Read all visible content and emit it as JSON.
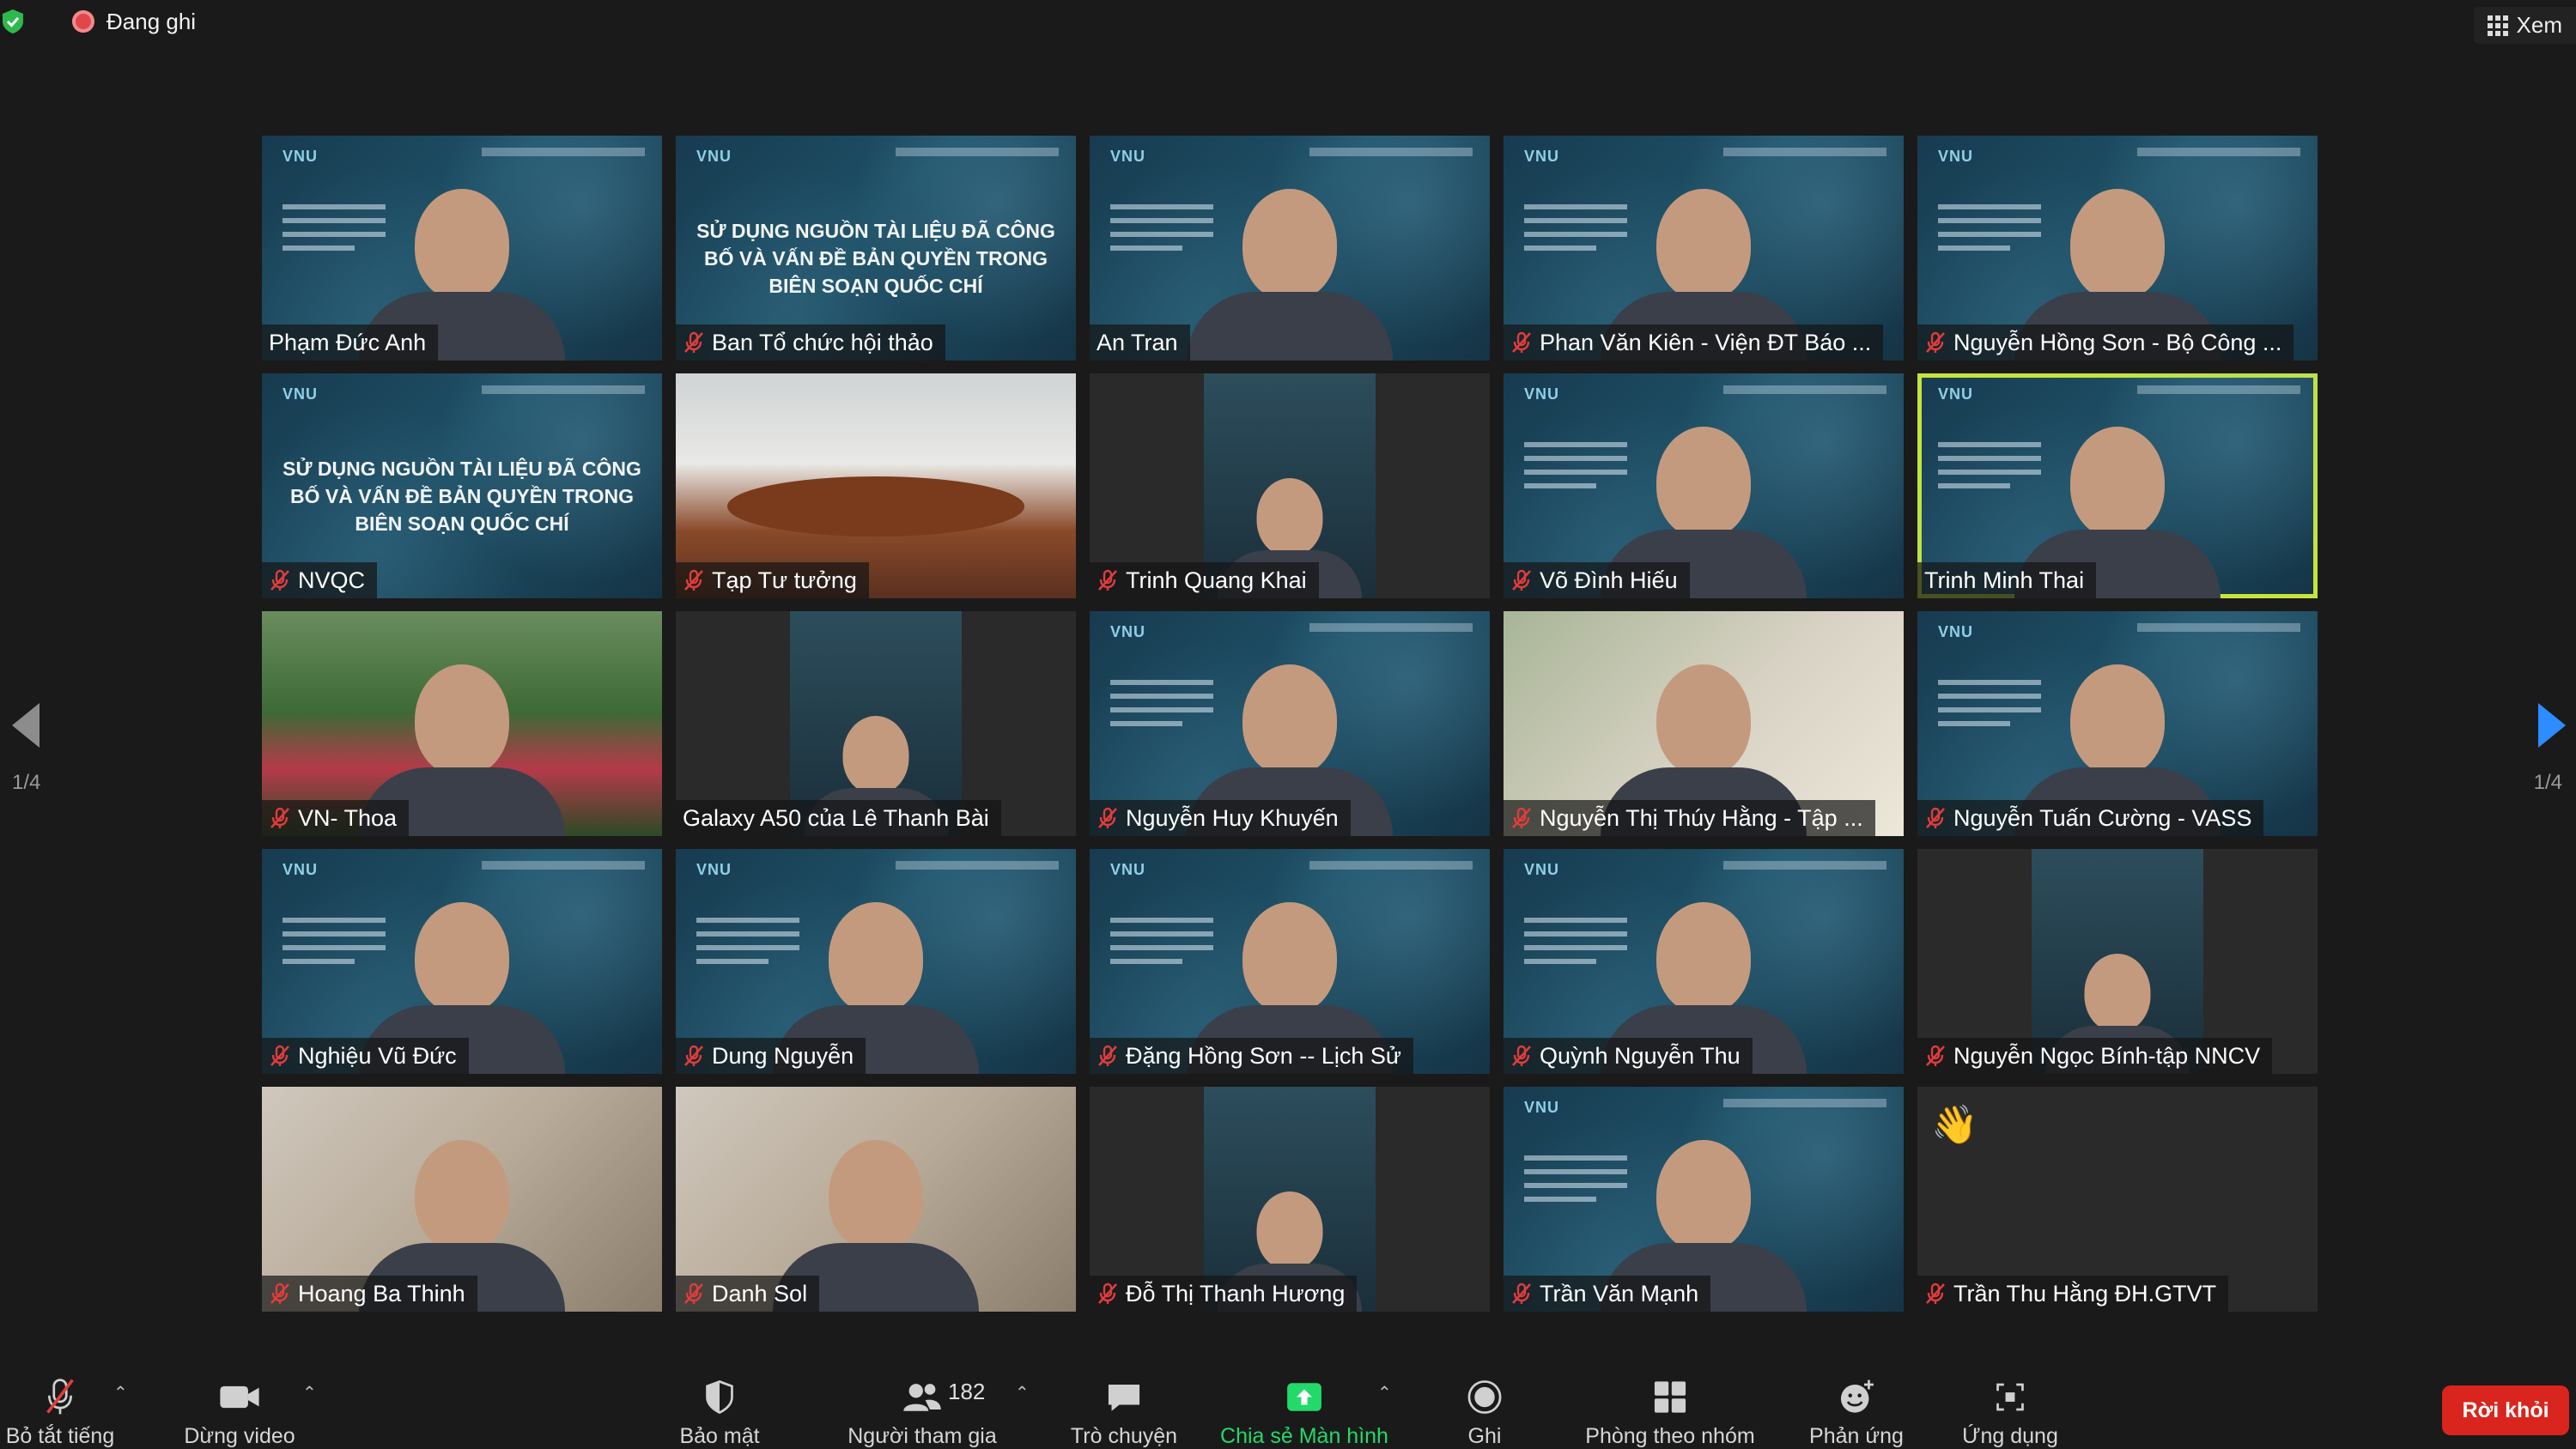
{
  "top_bar": {
    "recording_label": "Đang ghi",
    "view_label": "Xem"
  },
  "gallery": {
    "page_left": "1/4",
    "page_right": "1/4",
    "tiles": [
      {
        "name": "Phạm Đức Anh",
        "muted": false,
        "bg": "banner",
        "kind": "person",
        "title": ""
      },
      {
        "name": "Ban Tổ chức hội thảo",
        "muted": true,
        "bg": "banner",
        "kind": "title",
        "title": "SỬ DỤNG NGUỒN TÀI LIỆU ĐÃ CÔNG BỐ VÀ VẤN ĐỀ BẢN QUYỀN TRONG BIÊN SOẠN QUỐC CHÍ"
      },
      {
        "name": "An Tran",
        "muted": false,
        "bg": "banner",
        "kind": "person",
        "title": ""
      },
      {
        "name": "Phan Văn Kiên - Viện ĐT Báo ...",
        "muted": true,
        "bg": "banner",
        "kind": "person",
        "title": ""
      },
      {
        "name": "Nguyễn Hồng Sơn - Bộ Công ...",
        "muted": true,
        "bg": "banner",
        "kind": "person",
        "title": ""
      },
      {
        "name": "NVQC",
        "muted": true,
        "bg": "banner",
        "kind": "title",
        "title": "SỬ DỤNG NGUỒN TÀI LIỆU ĐÃ CÔNG BỐ VÀ VẤN ĐỀ BẢN QUYỀN TRONG BIÊN SOẠN QUỐC CHÍ"
      },
      {
        "name": "Tạp Tư tưởng",
        "muted": true,
        "bg": "room",
        "kind": "scene",
        "title": ""
      },
      {
        "name": "Trinh Quang Khai",
        "muted": true,
        "bg": "dark",
        "kind": "phone",
        "title": ""
      },
      {
        "name": "Võ Đình Hiếu",
        "muted": true,
        "bg": "banner",
        "kind": "person",
        "title": ""
      },
      {
        "name": "Trinh Minh Thai",
        "muted": false,
        "bg": "banner",
        "kind": "person",
        "title": "",
        "active": true
      },
      {
        "name": "VN- Thoa",
        "muted": true,
        "bg": "garden",
        "kind": "person",
        "title": ""
      },
      {
        "name": "Galaxy A50 của Lê Thanh Bài",
        "muted": false,
        "bg": "dark",
        "kind": "phone",
        "title": ""
      },
      {
        "name": "Nguyễn Huy Khuyến",
        "muted": true,
        "bg": "banner",
        "kind": "person",
        "title": ""
      },
      {
        "name": "Nguyễn Thị Thúy Hằng - Tập ...",
        "muted": true,
        "bg": "plant",
        "kind": "person",
        "title": ""
      },
      {
        "name": "Nguyễn Tuấn Cường - VASS",
        "muted": true,
        "bg": "banner",
        "kind": "person",
        "title": ""
      },
      {
        "name": "Nghiệu Vũ Đức",
        "muted": true,
        "bg": "banner",
        "kind": "person",
        "title": ""
      },
      {
        "name": "Dung Nguyễn",
        "muted": true,
        "bg": "banner",
        "kind": "person",
        "title": ""
      },
      {
        "name": "Đặng Hồng Sơn -- Lịch Sử",
        "muted": true,
        "bg": "banner",
        "kind": "person",
        "title": ""
      },
      {
        "name": "Quỳnh Nguyễn Thu",
        "muted": true,
        "bg": "banner",
        "kind": "person",
        "title": ""
      },
      {
        "name": "Nguyễn Ngọc Bính-tập NNCV",
        "muted": true,
        "bg": "dark",
        "kind": "phone",
        "title": ""
      },
      {
        "name": "Hoang Ba Thinh",
        "muted": true,
        "bg": "home",
        "kind": "person",
        "title": ""
      },
      {
        "name": "Danh Sol",
        "muted": true,
        "bg": "home",
        "kind": "person",
        "title": ""
      },
      {
        "name": "Đỗ Thị Thanh Hương",
        "muted": true,
        "bg": "dark",
        "kind": "phone",
        "title": ""
      },
      {
        "name": "Trần Văn Mạnh",
        "muted": true,
        "bg": "banner",
        "kind": "person",
        "title": ""
      },
      {
        "name": "Trần Thu Hằng ĐH.GTVT",
        "muted": true,
        "bg": "dark",
        "kind": "wave",
        "title": ""
      }
    ]
  },
  "toolbar": {
    "unmute_label": "Bỏ tắt tiếng",
    "video_label": "Dừng video",
    "security_label": "Bảo mật",
    "participants_label": "Người tham gia",
    "participants_count": "182",
    "chat_label": "Trò chuyện",
    "share_label": "Chia sẻ Màn hình",
    "record_label": "Ghi",
    "breakout_label": "Phòng theo nhóm",
    "reactions_label": "Phản ứng",
    "apps_label": "Ứng dụng",
    "leave_label": "Rời khỏi"
  },
  "colors": {
    "active_speaker": "#c6e43b",
    "share_green": "#23d96a",
    "leave_red": "#d9251d",
    "mute_red": "#e03c3c",
    "arrow_blue": "#2d8cff"
  }
}
